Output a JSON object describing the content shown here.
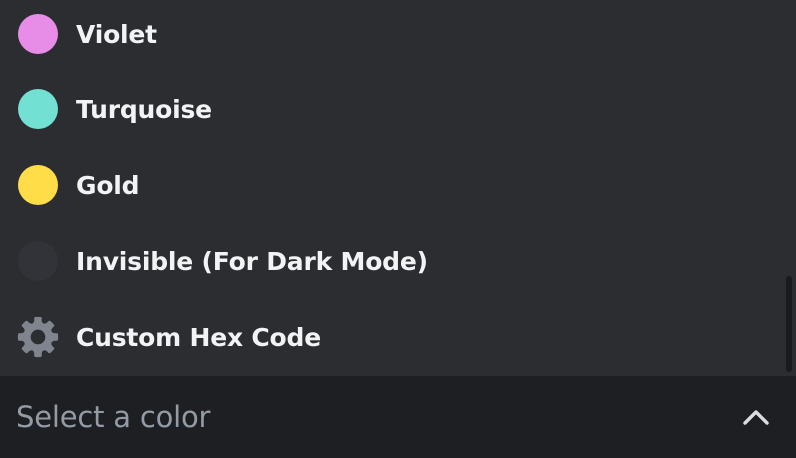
{
  "options": [
    {
      "label": "Violet",
      "color": "#e78de8",
      "icon": "color-swatch"
    },
    {
      "label": "Turquoise",
      "color": "#72e0d2",
      "icon": "color-swatch"
    },
    {
      "label": "Gold",
      "color": "#ffdd48",
      "icon": "color-swatch"
    },
    {
      "label": "Invisible (For Dark Mode)",
      "color": "#313338",
      "icon": "color-swatch"
    },
    {
      "label": "Custom Hex Code",
      "icon": "gear-icon",
      "icon_color": "#80848e"
    }
  ],
  "select": {
    "placeholder": "Select a color",
    "icon": "chevron-up-icon"
  },
  "colors": {
    "panel_bg": "#2b2d31",
    "select_bg": "#1e1f22",
    "text": "#f2f3f5",
    "placeholder": "#949ba4"
  }
}
